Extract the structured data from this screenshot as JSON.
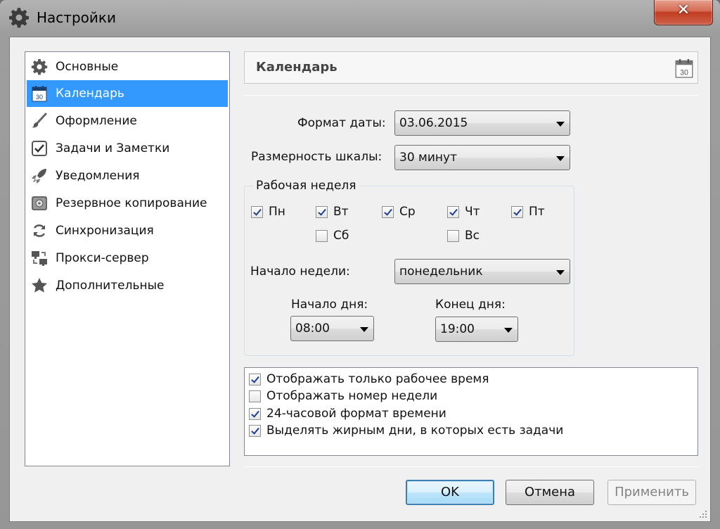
{
  "window": {
    "title": "Настройки",
    "close_glyph": "✕"
  },
  "sidebar": {
    "items": [
      {
        "label": "Основные",
        "icon": "gear-icon"
      },
      {
        "label": "Календарь",
        "icon": "calendar-icon",
        "selected": true
      },
      {
        "label": "Оформление",
        "icon": "brush-icon"
      },
      {
        "label": "Задачи и Заметки",
        "icon": "checkbox-icon"
      },
      {
        "label": "Уведомления",
        "icon": "rocket-icon"
      },
      {
        "label": "Резервное копирование",
        "icon": "disk-icon"
      },
      {
        "label": "Синхронизация",
        "icon": "sync-icon"
      },
      {
        "label": "Прокси-сервер",
        "icon": "network-icon"
      },
      {
        "label": "Дополнительные",
        "icon": "star-icon"
      }
    ]
  },
  "panel": {
    "title": "Календарь",
    "date_format": {
      "label": "Формат даты:",
      "value": "03.06.2015"
    },
    "scale": {
      "label": "Размерность шкалы:",
      "value": "30 минут"
    },
    "work_week": {
      "title": "Рабочая неделя",
      "days": [
        {
          "label": "Пн",
          "checked": true
        },
        {
          "label": "Вт",
          "checked": true
        },
        {
          "label": "Ср",
          "checked": true
        },
        {
          "label": "Чт",
          "checked": true
        },
        {
          "label": "Пт",
          "checked": true
        },
        {
          "label": "Сб",
          "checked": false
        },
        {
          "label": "Вс",
          "checked": false
        }
      ],
      "week_start": {
        "label": "Начало недели:",
        "value": "понедельник"
      },
      "day_start": {
        "label": "Начало дня:",
        "value": "08:00"
      },
      "day_end": {
        "label": "Конец дня:",
        "value": "19:00"
      }
    },
    "options": [
      {
        "label": "Отображать только рабочее время",
        "checked": true
      },
      {
        "label": "Отображать номер недели",
        "checked": false
      },
      {
        "label": "24-часовой формат времени",
        "checked": true
      },
      {
        "label": "Выделять жирным дни, в которых есть задачи",
        "checked": true
      }
    ]
  },
  "buttons": {
    "ok": "OK",
    "cancel": "Отмена",
    "apply": "Применить"
  },
  "colors": {
    "selection": "#3399ff",
    "close_button": "#c8432a",
    "default_button_border": "#3c7fb1"
  }
}
